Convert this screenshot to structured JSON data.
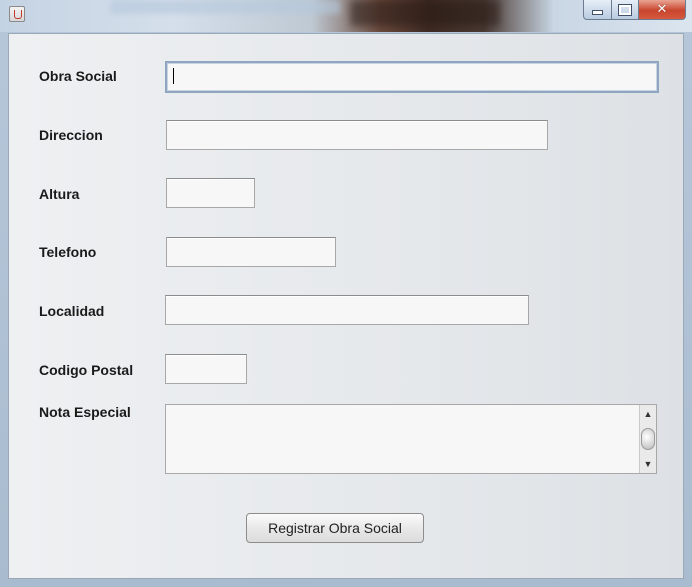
{
  "window": {
    "app_icon": "java-cup-icon",
    "controls": {
      "minimize": "minimize-icon",
      "maximize": "maximize-icon",
      "close": "close-icon",
      "close_glyph": "✕"
    }
  },
  "form": {
    "fields": {
      "obra_social": {
        "label": "Obra Social",
        "value": ""
      },
      "direccion": {
        "label": "Direccion",
        "value": ""
      },
      "altura": {
        "label": "Altura",
        "value": ""
      },
      "telefono": {
        "label": "Telefono",
        "value": ""
      },
      "localidad": {
        "label": "Localidad",
        "value": ""
      },
      "codigo_postal": {
        "label": "Codigo Postal",
        "value": ""
      },
      "nota_especial": {
        "label": "Nota Especial",
        "value": ""
      }
    },
    "submit_label": "Registrar Obra Social"
  },
  "colors": {
    "client_background": "#e5e8eb",
    "field_background": "#f7f7f7",
    "focus_border": "#8fa5c0",
    "close_button": "#c9452e"
  }
}
